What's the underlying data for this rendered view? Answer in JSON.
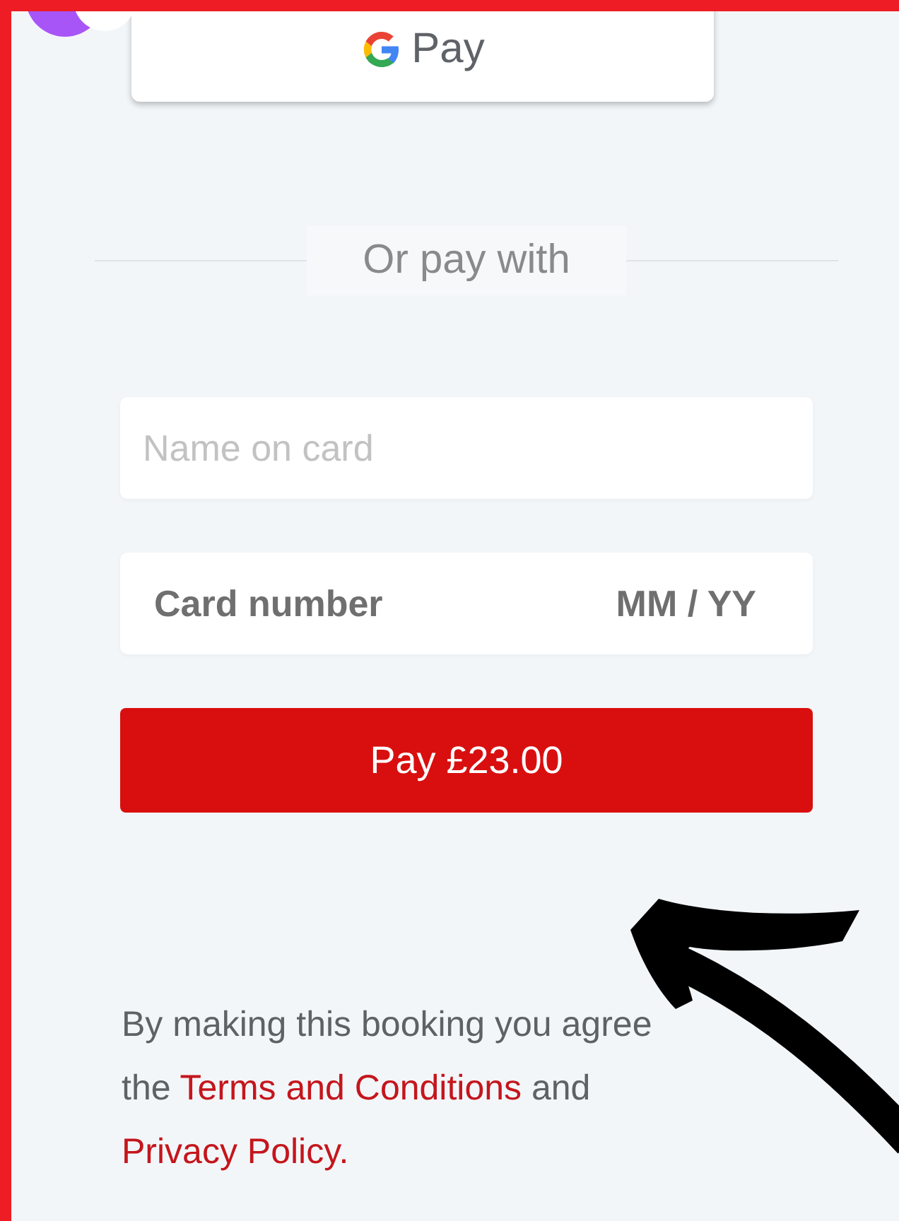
{
  "gpay_button": {
    "label": "Pay"
  },
  "divider": {
    "label": "Or pay with"
  },
  "name_field": {
    "placeholder": "Name on card"
  },
  "card_field": {
    "placeholder": "Card number",
    "expiry_placeholder": "MM / YY"
  },
  "pay_button": {
    "label": "Pay £23.00"
  },
  "terms": [
    {
      "kind": "plain",
      "text": "By making this booking you agree the "
    },
    {
      "kind": "link",
      "text": "Terms and Conditions"
    },
    {
      "kind": "plain",
      "text": " and "
    },
    {
      "kind": "link",
      "text": "Privacy Policy."
    }
  ]
}
